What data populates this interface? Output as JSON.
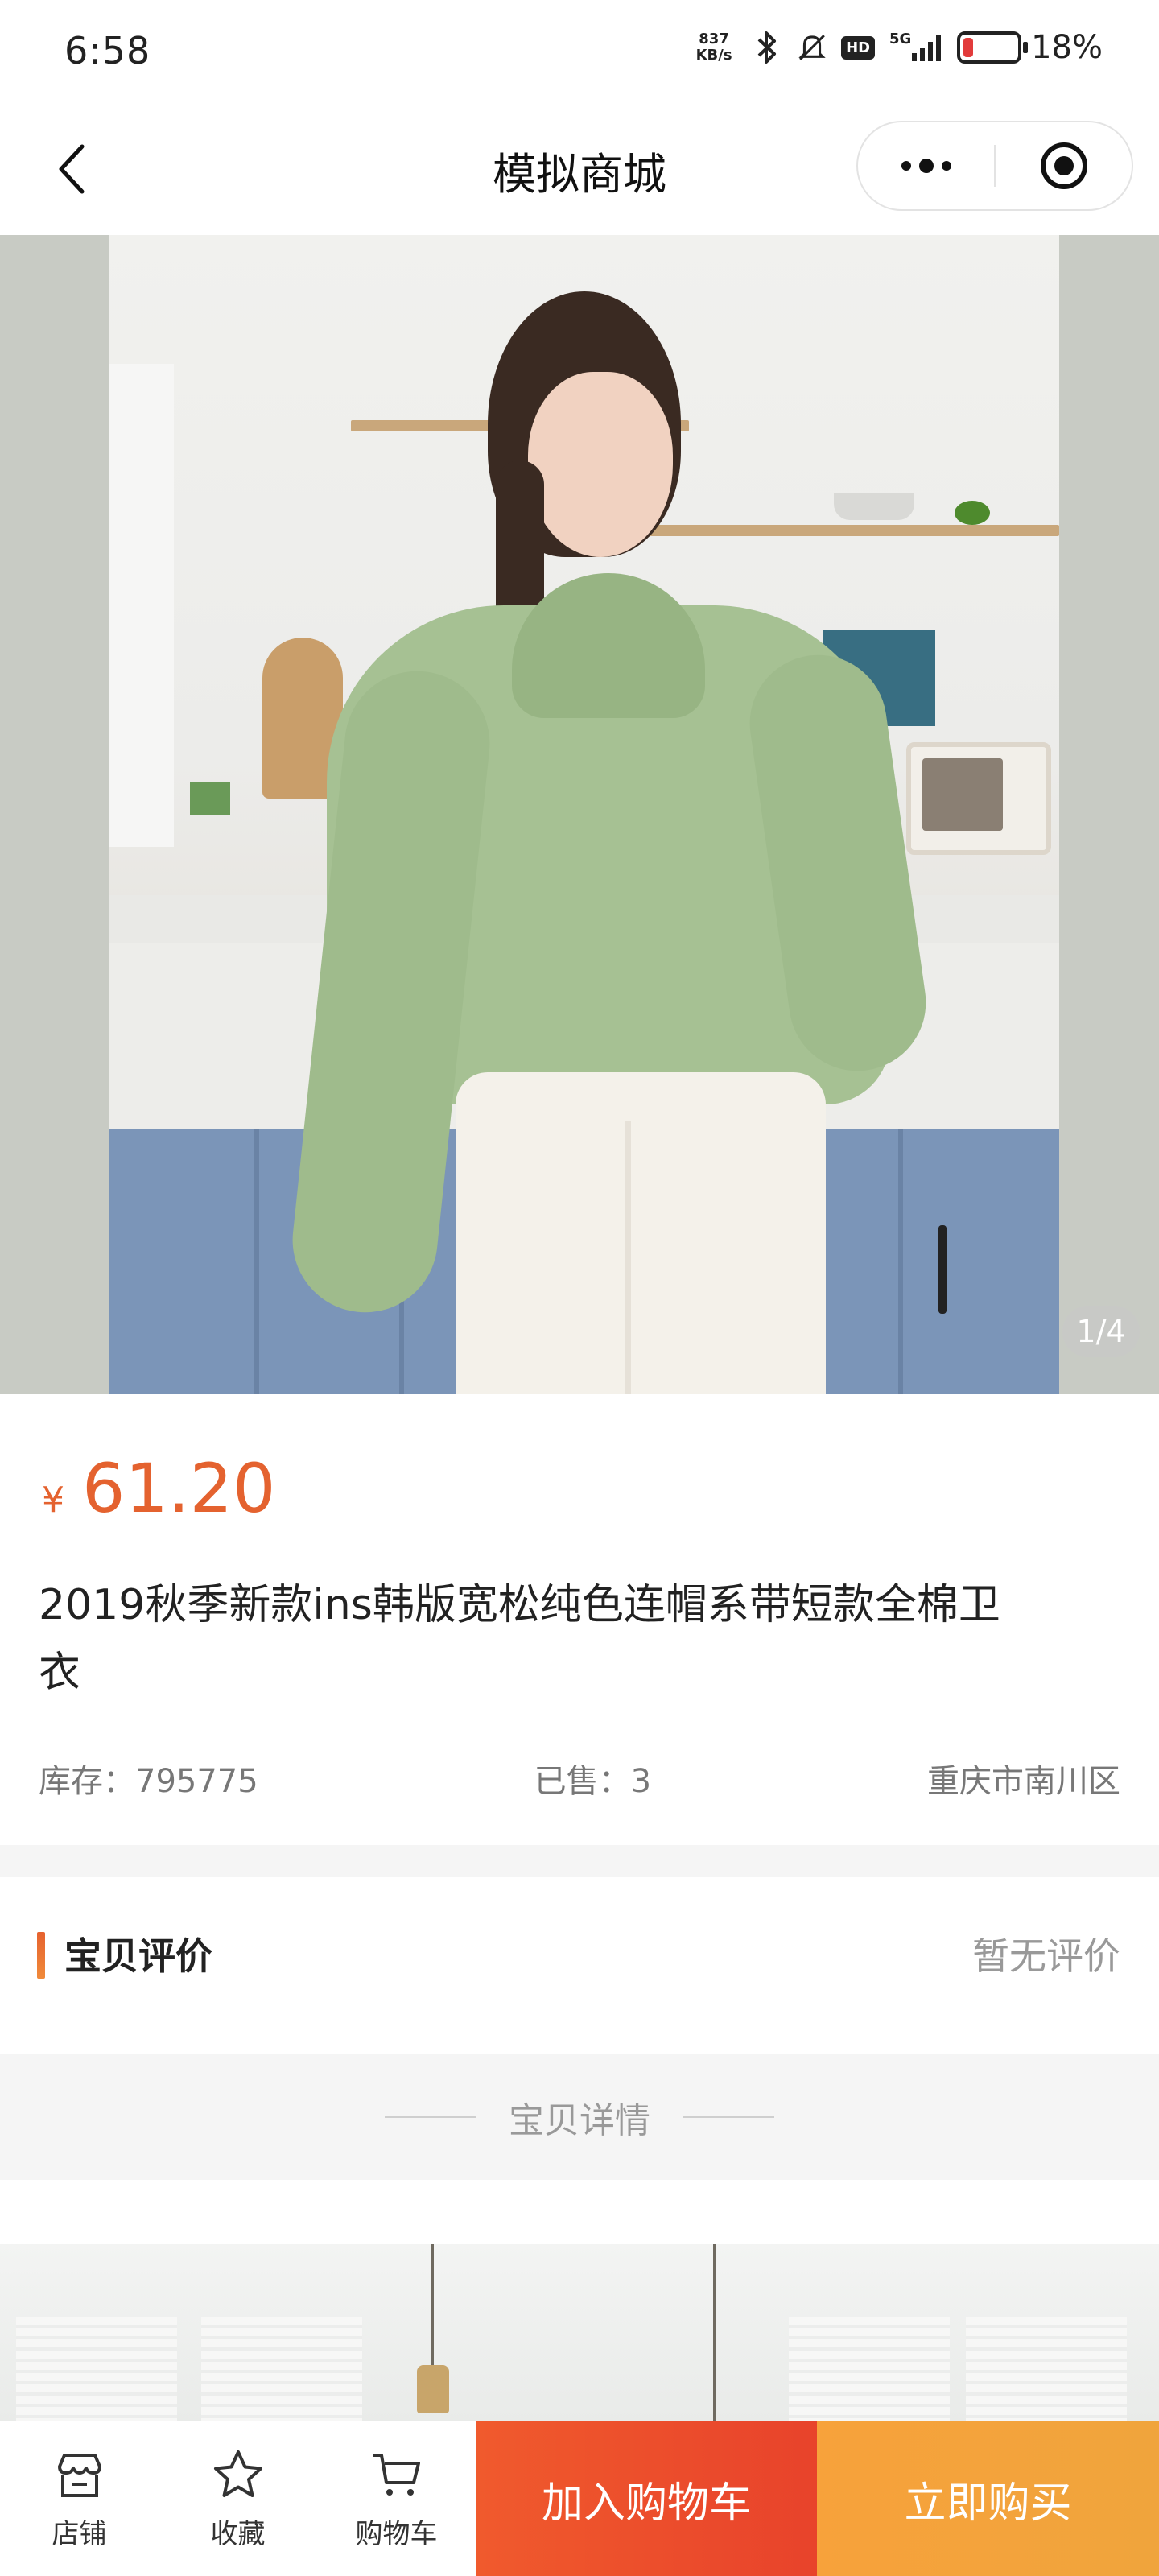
{
  "status_bar": {
    "time": "6:58",
    "net_speed_value": "837",
    "net_speed_unit": "KB/s",
    "hd": "HD",
    "signal": "5G",
    "battery_percent": "18%",
    "battery_level": 0.18,
    "icons": [
      "bluetooth-icon",
      "mute-icon",
      "hd-icon",
      "signal-icon",
      "battery-icon"
    ]
  },
  "nav": {
    "title": "模拟商城",
    "icons": [
      "back-icon",
      "more-icon",
      "target-icon"
    ]
  },
  "hero": {
    "counter": "1/4"
  },
  "product": {
    "price_symbol": "¥",
    "price": "61.20",
    "title": "2019秋季新款ins韩版宽松纯色连帽系带短款全棉卫衣",
    "stock": "库存：795775",
    "sold": "已售：3",
    "location": "重庆市南川区"
  },
  "review": {
    "title": "宝贝评价",
    "empty_text": "暂无评价"
  },
  "details": {
    "heading": "宝贝详情"
  },
  "bottom_bar": {
    "tabs": [
      {
        "label": "店铺",
        "icon": "store-icon"
      },
      {
        "label": "收藏",
        "icon": "star-icon"
      },
      {
        "label": "购物车",
        "icon": "cart-icon"
      }
    ],
    "add_to_cart": "加入购物车",
    "buy_now": "立即购买"
  },
  "colors": {
    "price": "#e4622f",
    "cart_button": "#e8432b",
    "buy_button": "#f0a43c"
  }
}
